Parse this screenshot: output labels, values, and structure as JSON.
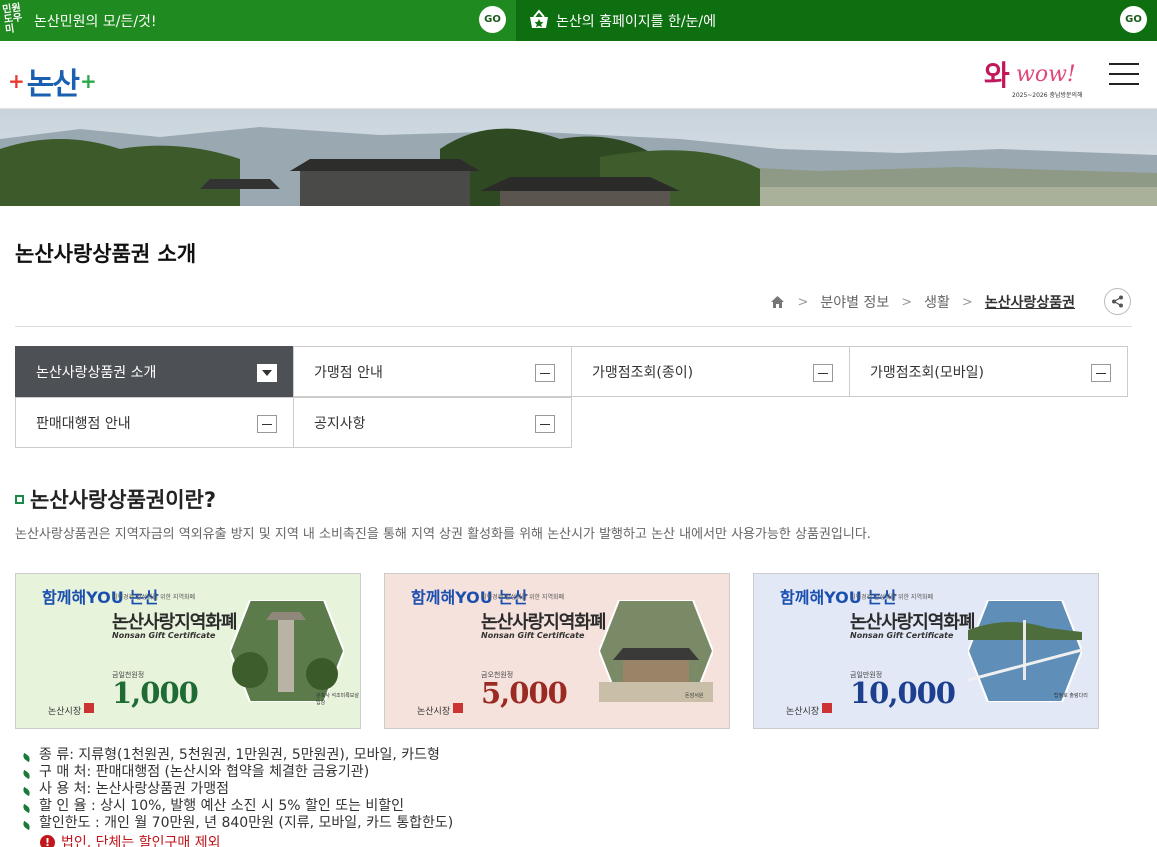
{
  "topbar": {
    "left_logo": "민원 도우미",
    "left_text": "논산민원의 모/든/것!",
    "left_go": "GO",
    "right_text": "논산의 홈페이지를 한/눈/에",
    "right_go": "GO"
  },
  "header": {
    "logo_name": "논산",
    "wow_text": "wow!",
    "wow_prefix": "와",
    "wow_sub": "2025~2026 충남방문의해"
  },
  "page_title": "논산사랑상품권 소개",
  "breadcrumb": {
    "items": [
      "분야별 정보",
      "생활",
      "논산사랑상품권"
    ]
  },
  "tabs": [
    {
      "label": "논산사랑상품권 소개",
      "active": true
    },
    {
      "label": "가맹점 안내",
      "active": false
    },
    {
      "label": "가맹점조회(종이)",
      "active": false
    },
    {
      "label": "가맹점조회(모바일)",
      "active": false
    },
    {
      "label": "판매대행점 안내",
      "active": false
    },
    {
      "label": "공지사항",
      "active": false
    }
  ],
  "section": {
    "title": "논산사랑상품권이란?",
    "desc": "논산사랑상품권은 지역자금의 역외유출 방지 및 지역 내 소비촉진을 통해 지역 상권 활성화를 위해 논산시가 발행하고 논산 내에서만 사용가능한 상품권입니다."
  },
  "vouchers": [
    {
      "brand": "함께해YOU 논산",
      "small": "지역경제 활성화를 위한 지역화폐",
      "title": "논산사랑지역화폐",
      "sub": "Nonsan Gift Certificate",
      "label": "금일천원정",
      "amount": "1,000",
      "issuer": "논산시장",
      "caption": "관촉사 석조미륵보살입상",
      "color": "#1f6b34",
      "bg": "#e8f3dc"
    },
    {
      "brand": "함께해YOU 논산",
      "small": "지역경제 활성화를 위한 지역화폐",
      "title": "논산사랑지역화폐",
      "sub": "Nonsan Gift Certificate",
      "label": "금오천원정",
      "amount": "5,000",
      "issuer": "논산시장",
      "caption": "돈암서원",
      "color": "#9a2a22",
      "bg": "#f6e2dc"
    },
    {
      "brand": "함께해YOU 논산",
      "small": "지역경제 활성화를 위한 지역화폐",
      "title": "논산사랑지역화폐",
      "sub": "Nonsan Gift Certificate",
      "label": "금일만원정",
      "amount": "10,000",
      "issuer": "논산시장",
      "caption": "탑정호 출렁다리",
      "color": "#1d3f8f",
      "bg": "#e2e8f5"
    }
  ],
  "info": [
    "종 류: 지류형(1천원권, 5천원권, 1만원권, 5만원권), 모바일, 카드형",
    "구 매 처: 판매대행점 (논산시와 협약을 체결한 금융기관)",
    "사 용 처: 논산사랑상품권 가맹점",
    "할 인 율 : 상시 10%, 발행 예산 소진 시 5% 할인 또는 비할인",
    "할인한도 : 개인 월 70만원, 년 840만원 (지류, 모바일, 카드 통합한도)"
  ],
  "warning": "법인, 단체는 할인구매 제외",
  "colors": {
    "topbar_left": "#1f8a1f",
    "topbar_right": "#0e6f10",
    "active_tab": "#4d5156",
    "warning": "#c0161c"
  }
}
